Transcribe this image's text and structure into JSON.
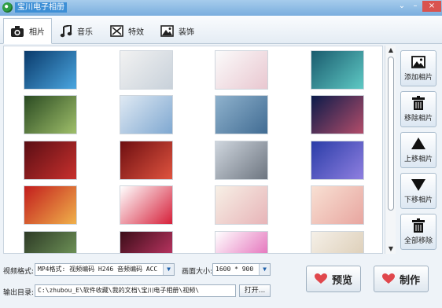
{
  "window": {
    "title": "宝川电子相册",
    "controls": [
      "⌄",
      "–",
      "×"
    ]
  },
  "tabs": [
    {
      "label": "相片",
      "icon": "camera-icon",
      "active": true
    },
    {
      "label": "音乐",
      "icon": "music-note-icon",
      "active": false
    },
    {
      "label": "特效",
      "icon": "effects-icon",
      "active": false
    },
    {
      "label": "装饰",
      "icon": "decoration-picture-icon",
      "active": false
    }
  ],
  "photos": [
    {
      "name": "night-lake",
      "c1": "#0a3a6b",
      "c2": "#4aa6e0"
    },
    {
      "name": "white-horses",
      "c1": "#f2f2f2",
      "c2": "#c8d1da"
    },
    {
      "name": "flower-wreath",
      "c1": "#fbfbfb",
      "c2": "#e9c7d0"
    },
    {
      "name": "fairy-girl",
      "c1": "#1a5b6e",
      "c2": "#5ec9c4"
    },
    {
      "name": "fantasy-girl-garden",
      "c1": "#2a4a22",
      "c2": "#9fbf6a"
    },
    {
      "name": "snowy-road",
      "c1": "#dfe9f3",
      "c2": "#7fa8d1"
    },
    {
      "name": "misty-sky",
      "c1": "#8fb2cd",
      "c2": "#416c93"
    },
    {
      "name": "night-mountain",
      "c1": "#0b1b4a",
      "c2": "#b34d6a"
    },
    {
      "name": "christmas-snowman",
      "c1": "#5a0e14",
      "c2": "#c8302d"
    },
    {
      "name": "tea-cup-roses",
      "c1": "#6e0f11",
      "c2": "#e0533f"
    },
    {
      "name": "girl-portrait",
      "c1": "#cfd6de",
      "c2": "#6d7580"
    },
    {
      "name": "blue-hydrangea",
      "c1": "#2a3da8",
      "c2": "#8f7fe0"
    },
    {
      "name": "new-year-2015",
      "c1": "#c21d1d",
      "c2": "#f0b14a"
    },
    {
      "name": "anime-girl",
      "c1": "#ffffff",
      "c2": "#d6203a"
    },
    {
      "name": "egg-couple",
      "c1": "#f7f0e6",
      "c2": "#e7b4b8"
    },
    {
      "name": "pink-blossom",
      "c1": "#f8e0d3",
      "c2": "#e8a6a0"
    },
    {
      "name": "girl-dark",
      "c1": "#2d3a26",
      "c2": "#7aa360"
    },
    {
      "name": "pink-rose",
      "c1": "#3b0d18",
      "c2": "#d13b6e"
    },
    {
      "name": "cartoon-pink",
      "c1": "#ffffff",
      "c2": "#e05bb0"
    },
    {
      "name": "cute-figures",
      "c1": "#f5f0e8",
      "c2": "#d9c9b0"
    }
  ],
  "side_buttons": [
    {
      "label": "添加相片",
      "icon": "add-photo-icon"
    },
    {
      "label": "移除相片",
      "icon": "trash-icon"
    },
    {
      "label": "上移相片",
      "icon": "move-up-icon"
    },
    {
      "label": "下移相片",
      "icon": "move-down-icon"
    },
    {
      "label": "全部移除",
      "icon": "trash-icon"
    }
  ],
  "video_format": {
    "label": "视频格式:",
    "value": "MP4格式: 视频编码 H246 音频编码 ACC"
  },
  "frame_size": {
    "label": "画面大小:",
    "value": "1600 * 900"
  },
  "output_dir": {
    "label": "输出目录:",
    "value": "C:\\zhubou_E\\软件收藏\\我的文档\\宝川电子相册\\视频\\",
    "open_label": "打开..."
  },
  "actions": {
    "preview_label": "预览",
    "make_label": "制作"
  },
  "colors": {
    "accent": "#d9534f",
    "titlebar": "#7aaede",
    "heart": "#e0474c"
  }
}
